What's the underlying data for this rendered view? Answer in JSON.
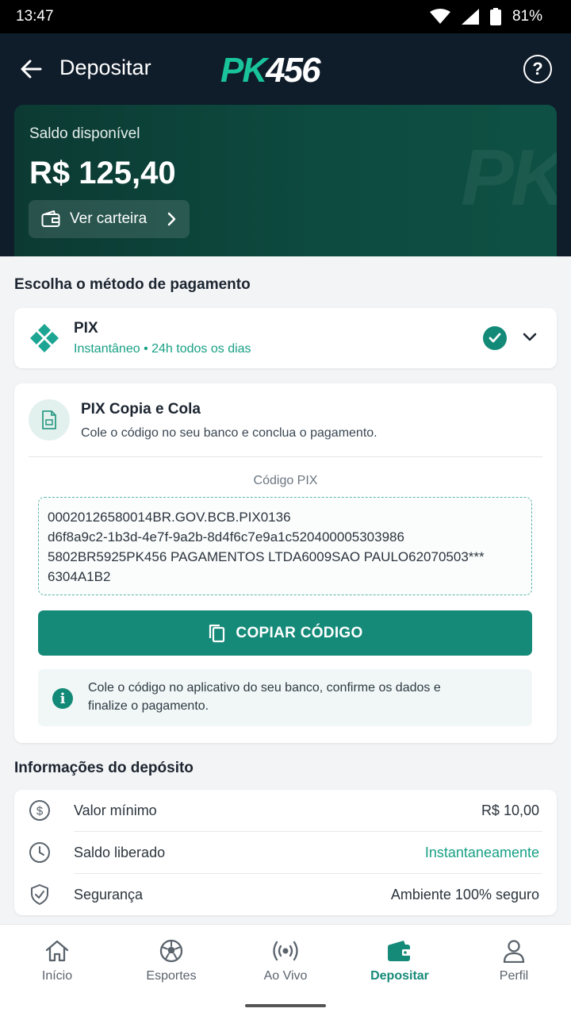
{
  "status_bar": {
    "time": "13:47",
    "battery": "81%"
  },
  "header": {
    "title": "Depositar",
    "logo_pk": "PK",
    "logo_num": "456",
    "help": "?"
  },
  "balance": {
    "label": "Saldo disponível",
    "value": "R$ 125,40",
    "wallet_button": "Ver carteira",
    "watermark": "PK"
  },
  "payment": {
    "section_title": "Escolha o método de pagamento",
    "method_name": "PIX",
    "method_sub": "Instantâneo • 24h todos os dias"
  },
  "pix_copy": {
    "title": "PIX Copia e Cola",
    "subtitle": "Cole o código no seu banco e conclua o pagamento.",
    "code_label": "Código PIX",
    "code_lines": [
      "00020126580014BR.GOV.BCB.PIX0136",
      "d6f8a9c2-1b3d-4e7f-9a2b-8d4f6c7e9a1c520400005303986",
      "5802BR5925PK456 PAGAMENTOS LTDA6009SAO PAULO62070503***",
      "6304A1B2"
    ],
    "copy_button": "COPIAR CÓDIGO",
    "info_text": "Cole o código no aplicativo do seu banco, confirme os dados e finalize o pagamento."
  },
  "details": {
    "section_title": "Informações do depósito",
    "rows": [
      {
        "label": "Valor mínimo",
        "value": "R$ 10,00",
        "icon": "dollar-icon"
      },
      {
        "label": "Saldo liberado",
        "value": "Instantaneamente",
        "icon": "clock-icon"
      },
      {
        "label": "Segurança",
        "value": "Ambiente 100% seguro",
        "icon": "shield-icon"
      }
    ]
  },
  "nav": {
    "items": [
      {
        "label": "Início",
        "icon": "home-icon"
      },
      {
        "label": "Esportes",
        "icon": "soccer-ball-icon"
      },
      {
        "label": "Ao Vivo",
        "icon": "live-broadcast-icon"
      },
      {
        "label": "Depositar",
        "icon": "wallet-icon",
        "active": true
      },
      {
        "label": "Perfil",
        "icon": "user-icon"
      }
    ]
  },
  "colors": {
    "accent": "#168a79",
    "header_bg": "#0f1c2a",
    "logo_green": "#19c49a"
  }
}
